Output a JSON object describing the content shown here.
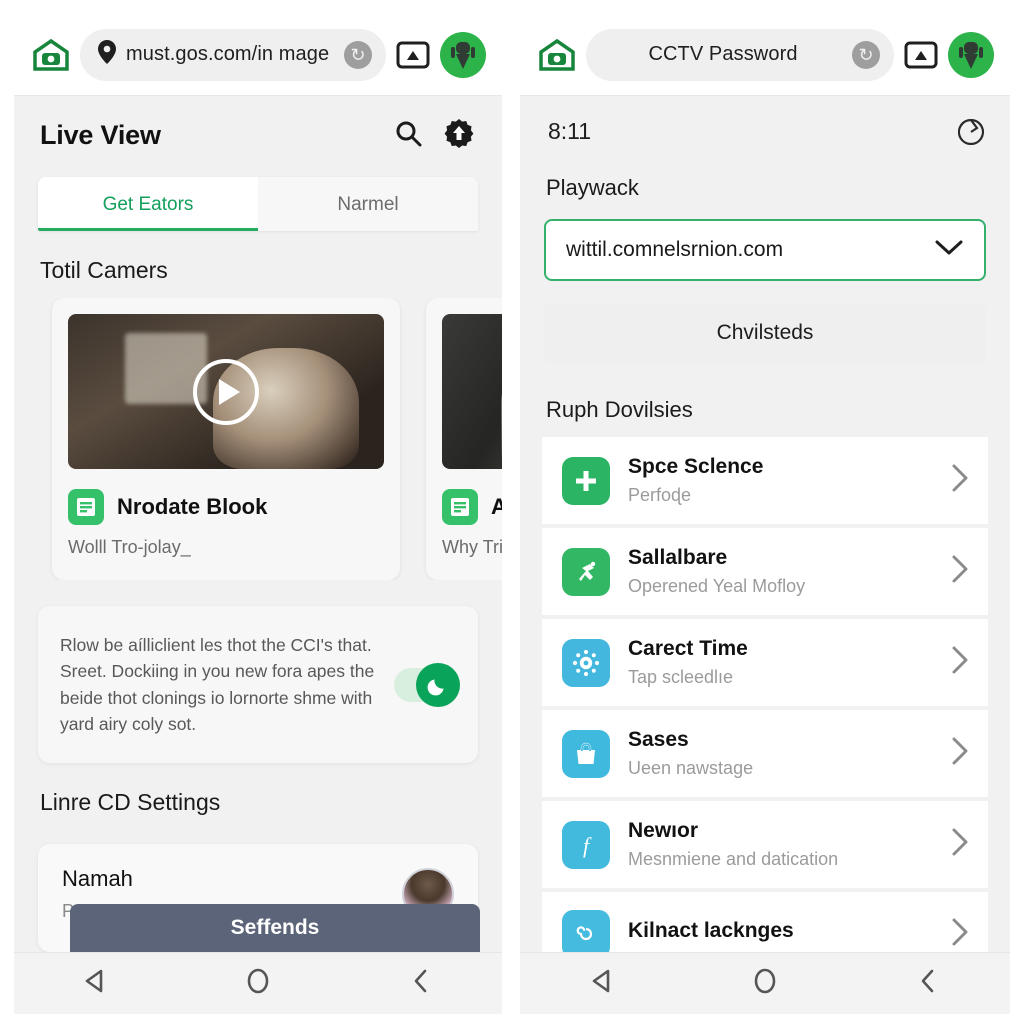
{
  "left": {
    "chrome": {
      "home_icon": "home-camera-icon",
      "url": "must.gos.com/in mage",
      "reload_icon": "reload-icon",
      "cast_icon": "cast-icon",
      "avatar_icon": "android-avatar-icon"
    },
    "header": {
      "title": "Live View",
      "search_icon": "search-icon",
      "upload_icon": "cloud-upload-icon"
    },
    "tabs": [
      {
        "label": "Get Eators",
        "active": true
      },
      {
        "label": "Narmel",
        "active": false
      }
    ],
    "section_title": "Totil Camers",
    "cards": [
      {
        "icon": "document-list-icon",
        "title": "Nrodate Blook",
        "subtitle": "Wolll Tro-jolay_",
        "play_icon": "play-icon"
      },
      {
        "icon": "document-list-icon",
        "title": "Alr",
        "subtitle": "Why Tris"
      }
    ],
    "note": {
      "text": "Rlow be aílliclient les thot the CCI's that. Sreet. Dockiing in you new fora apes the beide thot clonings io lornorte shme with yard airy coly sot.",
      "toggle_on": true,
      "toggle_icon": "moon-icon"
    },
    "settings_title": "Linre CD Settings",
    "profile": {
      "name": "Namah",
      "subtitle": "Peopes AC Desag",
      "avatar": "user-avatar"
    },
    "cta_label": "Seffends",
    "navbar": {
      "back_icon": "triangle-back-icon",
      "home_icon": "circle-home-icon",
      "recents_icon": "chevron-back-icon"
    }
  },
  "right": {
    "chrome": {
      "home_icon": "home-camera-icon",
      "url": "CCTV  Password",
      "reload_icon": "reload-icon",
      "cast_icon": "cast-icon",
      "avatar_icon": "android-avatar-icon"
    },
    "status": {
      "clock": "8:11",
      "status_icon": "circle-status-icon"
    },
    "field_label": "Playwack",
    "select": {
      "value": "wittil.comnelsrnion.com",
      "caret_icon": "chevron-down-icon"
    },
    "ghost_button": "Chvilsteds",
    "list_title": "Ruph Dovilsies",
    "rows": [
      {
        "title": "Spce Sclence",
        "subtitle": "Perfoɖe",
        "icon": "plus-icon",
        "color": "#2bb463"
      },
      {
        "title": "Sallalbare",
        "subtitle": "Operened Yeal Mofloy",
        "icon": "runner-icon",
        "color": "#32b864"
      },
      {
        "title": "Carect Time",
        "subtitle": "Tap scleedlıe",
        "icon": "gear-sun-icon",
        "color": "#43b7dd"
      },
      {
        "title": "Sases",
        "subtitle": "Ueen nawstage",
        "icon": "bag-icon",
        "color": "#3fb9de"
      },
      {
        "title": "Newıor",
        "subtitle": "Mesnmiene and datication",
        "icon": "f-script-icon",
        "color": "#41bade"
      },
      {
        "title": "Kilnact lacknges",
        "subtitle": "",
        "icon": "spiral-icon",
        "color": "#45bcdf"
      }
    ],
    "chevron_icon": "chevron-right-icon",
    "navbar": {
      "back_icon": "triangle-back-icon",
      "home_icon": "circle-home-icon",
      "recents_icon": "chevron-back-icon"
    }
  },
  "colors": {
    "accent_green": "#23ab5e",
    "cta_slate": "#5b6478",
    "page_bg": "#f1f1f1"
  }
}
